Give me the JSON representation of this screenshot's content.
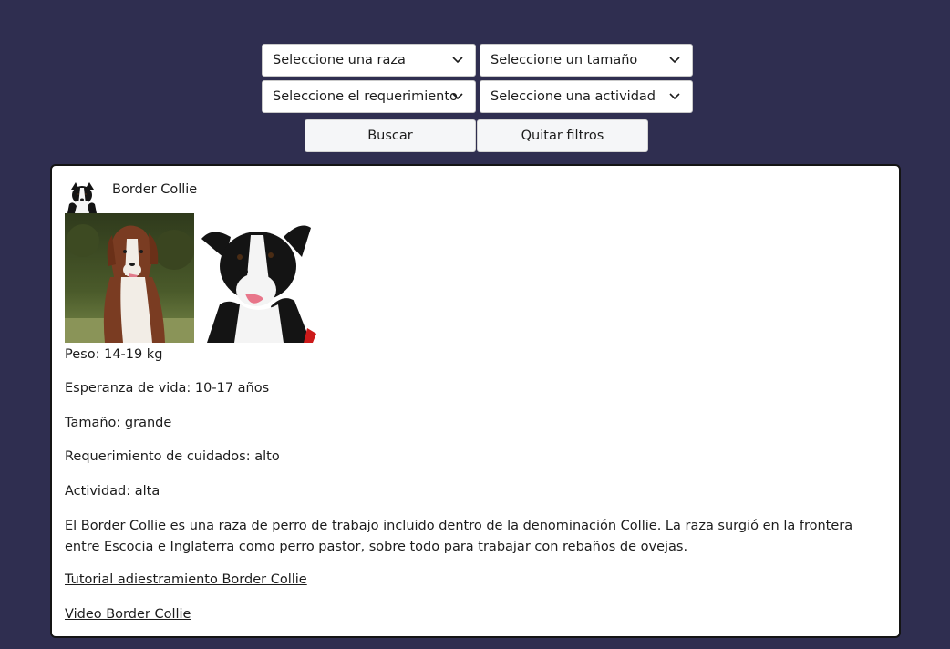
{
  "filters": {
    "breed_select": "Seleccione una raza",
    "size_select": "Seleccione un tamaño",
    "requirement_select": "Seleccione el requerimiento",
    "activity_select": "Seleccione una actividad",
    "search_button": "Buscar",
    "clear_button": "Quitar filtros"
  },
  "breed": {
    "name": "Border Collie",
    "weight": "Peso: 14-19 kg",
    "lifespan": "Esperanza de vida: 10-17 años",
    "size": "Tamaño: grande",
    "care": "Requerimiento de cuidados: alto",
    "activity": "Actividad: alta",
    "description": "El Border Collie es una raza de perro de trabajo incluido dentro de la denominación Collie. La raza surgió en la frontera entre Escocia e Inglaterra como perro pastor, sobre todo para trabajar con rebaños de ovejas.",
    "tutorial_link": "Tutorial adiestramiento Border Collie",
    "video_link": "Video Border Collie"
  },
  "icons": {
    "select_chevron": "chevron-down-icon"
  },
  "colors": {
    "page_background": "#2f2e50",
    "card_background": "#ffffff",
    "button_background": "#f5f6f8"
  }
}
